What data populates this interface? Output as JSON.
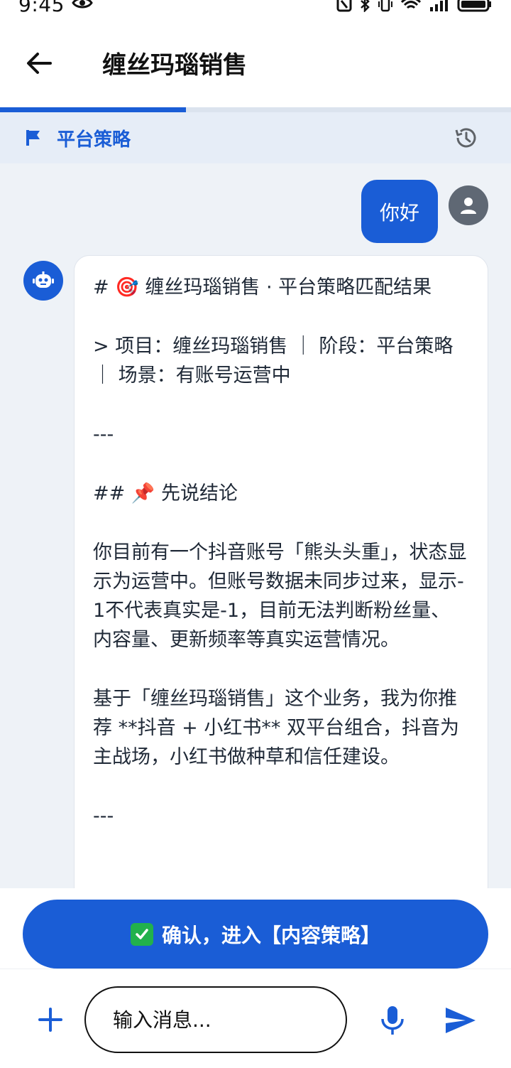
{
  "status_bar": {
    "time": "9:45"
  },
  "app_bar": {
    "title": "缠丝玛瑙销售"
  },
  "progress": {
    "fraction": 0.364
  },
  "stage": {
    "label": "平台策略"
  },
  "chat": {
    "user_message": "你好",
    "bot_message_lines": [
      "# 🎯 缠丝玛瑙销售 · 平台策略匹配结果",
      "",
      "> 项目：缠丝玛瑙销售 ｜ 阶段：平台策略 ｜ 场景：有账号运营中",
      "",
      "---",
      "",
      "## 📌 先说结论",
      "",
      "你目前有一个抖音账号「熊头头重」，状态显示为运营中。但账号数据未同步过来，显示-1不代表真实是-1，目前无法判断粉丝量、内容量、更新频率等真实运营情况。",
      "",
      "基于「缠丝玛瑙销售」这个业务，我为你推荐 **抖音 + 小红书** 双平台组合，抖音为主战场，小红书做种草和信任建设。",
      "",
      "---"
    ]
  },
  "confirm_button": {
    "label": "确认，进入【内容策略】"
  },
  "input": {
    "placeholder": "输入消息..."
  },
  "colors": {
    "primary": "#1a5dd6",
    "stage_bg": "#e6edf7",
    "chat_bg": "#eef2f7",
    "confirm_check": "#22b14c"
  },
  "icons": [
    "back-arrow-icon",
    "flag-icon",
    "history-icon",
    "person-icon",
    "robot-icon",
    "check-icon",
    "plus-icon",
    "mic-icon",
    "send-icon",
    "eye-icon",
    "nfc-icon",
    "bluetooth-icon",
    "vibrate-icon",
    "wifi-icon",
    "signal-icon",
    "battery-icon"
  ]
}
